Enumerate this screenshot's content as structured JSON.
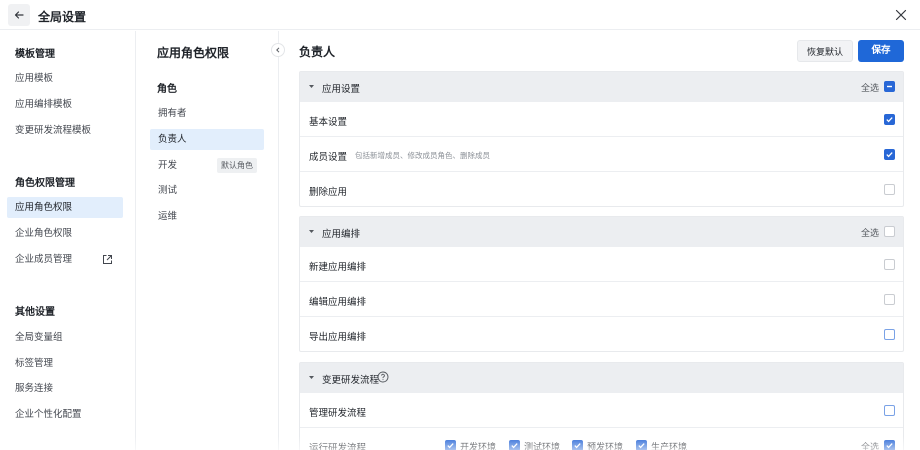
{
  "header": {
    "title": "全局设置"
  },
  "sidebar": {
    "groups": [
      {
        "title": "模板管理",
        "items": [
          {
            "label": "应用模板"
          },
          {
            "label": "应用编排模板"
          },
          {
            "label": "变更研发流程模板"
          }
        ]
      },
      {
        "title": "角色权限管理",
        "items": [
          {
            "label": "应用角色权限",
            "active": true
          },
          {
            "label": "企业角色权限"
          },
          {
            "label": "企业成员管理",
            "icon": "external-link-icon"
          }
        ]
      },
      {
        "title": "其他设置",
        "items": [
          {
            "label": "全局变量组"
          },
          {
            "label": "标签管理"
          },
          {
            "label": "服务连接"
          },
          {
            "label": "企业个性化配置"
          }
        ]
      }
    ]
  },
  "roles": {
    "title": "应用角色权限",
    "subtitle": "角色",
    "items": [
      {
        "label": "拥有者"
      },
      {
        "label": "负责人",
        "active": true
      },
      {
        "label": "开发",
        "tag": "默认角色"
      },
      {
        "label": "测试"
      },
      {
        "label": "运维"
      }
    ]
  },
  "main": {
    "title": "负责人",
    "reset_label": "恢复默认",
    "save_label": "保存",
    "sections": [
      {
        "title": "应用设置",
        "select_all": "全选",
        "select_all_state": "indeterminate",
        "rows": [
          {
            "label": "基本设置",
            "checked": true
          },
          {
            "label": "成员设置",
            "desc": "包括新增成员、修改成员角色、删除成员",
            "checked": true
          },
          {
            "label": "删除应用",
            "checked": false
          }
        ]
      },
      {
        "title": "应用编排",
        "select_all": "全选",
        "select_all_state": "unchecked",
        "rows": [
          {
            "label": "新建应用编排",
            "checked": false
          },
          {
            "label": "编辑应用编排",
            "checked": false
          },
          {
            "label": "导出应用编排",
            "checked": false,
            "focus": true
          }
        ]
      },
      {
        "title": "变更研发流程",
        "has_help": true,
        "rows": [
          {
            "label": "管理研发流程",
            "checked": false,
            "focus": true
          },
          {
            "label": "运行研发流程",
            "select_all": "全选",
            "checked": true,
            "envs": [
              {
                "label": "开发环境",
                "checked": true
              },
              {
                "label": "测试环境",
                "checked": true
              },
              {
                "label": "预发环境",
                "checked": true
              },
              {
                "label": "生产环境",
                "checked": true
              }
            ]
          }
        ]
      }
    ]
  },
  "colors": {
    "accent": "#1f68d8",
    "active_bg": "#e2eefc",
    "section_header_bg": "#eceef1"
  }
}
